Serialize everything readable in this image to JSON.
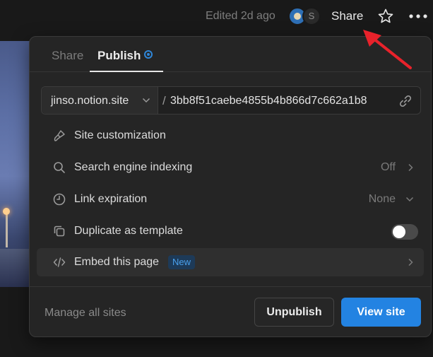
{
  "topbar": {
    "edited": "Edited 2d ago",
    "avatar_initial": "S",
    "share_label": "Share",
    "star_icon": "star-icon",
    "more_icon": "more-horizontal-icon"
  },
  "popover": {
    "tabs": [
      {
        "label": "Share",
        "active": false
      },
      {
        "label": "Publish",
        "active": true
      }
    ],
    "url": {
      "domain": "jinso.notion.site",
      "slash": "/",
      "slug": "3bb8f51caebe4855b4b866d7c662a1b8"
    },
    "rows": [
      {
        "label": "Site customization",
        "icon": "brush-icon"
      },
      {
        "label": "Search engine indexing",
        "value": "Off",
        "icon": "search-icon"
      },
      {
        "label": "Link expiration",
        "value": "None",
        "icon": "clock-icon"
      },
      {
        "label": "Duplicate as template",
        "icon": "duplicate-icon",
        "toggle": false
      },
      {
        "label": "Embed this page",
        "badge": "New",
        "icon": "code-icon"
      }
    ],
    "footer": {
      "manage_label": "Manage all sites",
      "unpublish_label": "Unpublish",
      "view_label": "View site"
    }
  },
  "colors": {
    "background": "#191919",
    "panel": "#252525",
    "accent": "#2383e2",
    "arrow": "#e8222b"
  }
}
